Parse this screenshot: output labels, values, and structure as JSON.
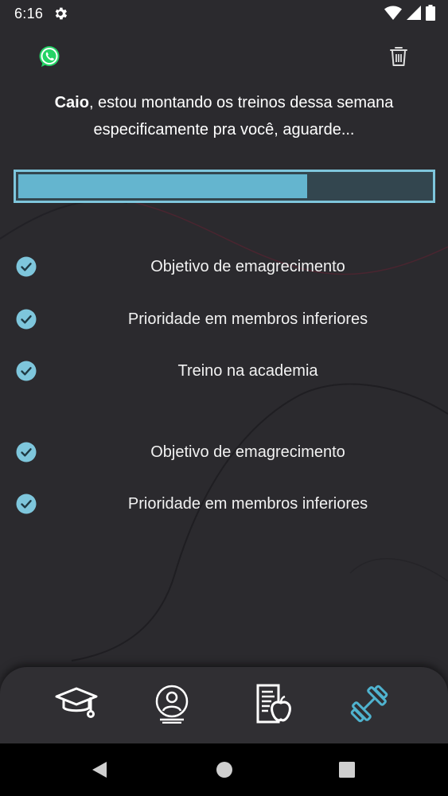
{
  "status_bar": {
    "time": "6:16",
    "icons": [
      "gear-icon",
      "wifi-icon",
      "signal-icon",
      "battery-icon"
    ]
  },
  "header": {
    "whatsapp_icon": "whatsapp-icon",
    "delete_icon": "trash-icon"
  },
  "message": {
    "user_name": "Caio",
    "text": ", estou montando os treinos dessa semana especificamente pra você, aguarde..."
  },
  "progress": {
    "value_percent": 70,
    "fill_color": "#64b5cf",
    "track_color": "#33464f",
    "border_color": "#7ec6dc"
  },
  "checklist": [
    {
      "label": "Objetivo de emagrecimento",
      "done": true
    },
    {
      "label": "Prioridade em membros inferiores",
      "done": true
    },
    {
      "label": "Treino na academia",
      "done": true
    },
    {
      "label": "Objetivo de emagrecimento",
      "done": true
    },
    {
      "label": "Prioridade em membros inferiores",
      "done": true
    }
  ],
  "bottom_nav": {
    "items": [
      {
        "icon": "graduation-cap-icon",
        "active": false
      },
      {
        "icon": "profile-icon",
        "active": false
      },
      {
        "icon": "nutrition-document-icon",
        "active": false
      },
      {
        "icon": "dumbbell-icon",
        "active": true
      }
    ],
    "active_color": "#4fb3cf"
  },
  "system_nav": {
    "icons": [
      "back-icon",
      "home-icon",
      "recents-icon"
    ]
  },
  "colors": {
    "background": "#2b2a2e",
    "check": "#7ec6dc"
  }
}
